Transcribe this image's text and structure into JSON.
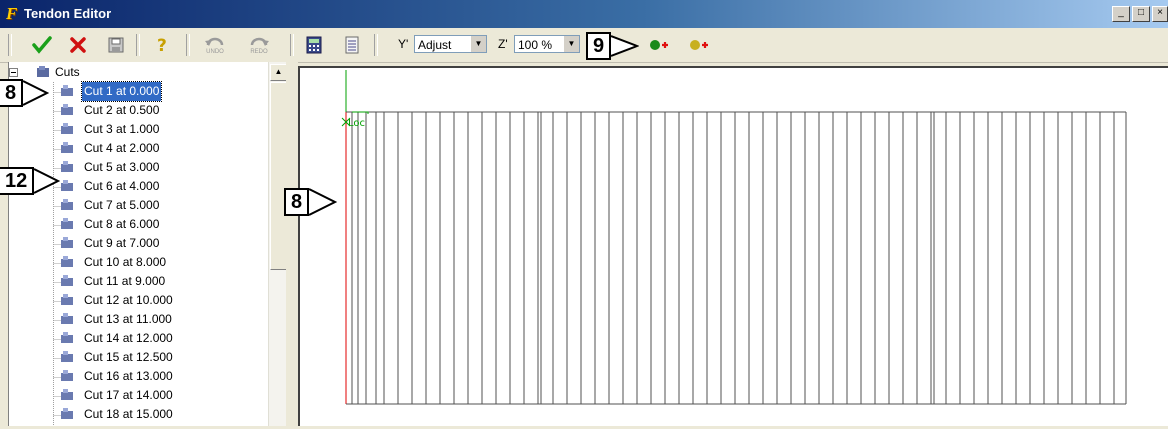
{
  "window": {
    "title": "Tendon Editor",
    "min": "_",
    "max": "□",
    "close": "×"
  },
  "toolbar": {
    "accept_icon": "check-icon",
    "y_label": "Y'",
    "y_combo": "Adjust",
    "z_label": "Z'",
    "zoom_combo": "100 %",
    "undo_label": "UNDO",
    "redo_label": "REDO"
  },
  "callouts": {
    "toolbar": "9",
    "tree_top": "8",
    "tree_mid": "12",
    "canvas": "8"
  },
  "tree": {
    "root": "Cuts",
    "items": [
      "Cut 1 at 0.000",
      "Cut 2 at 0.500",
      "Cut 3 at 1.000",
      "Cut 4 at 2.000",
      "Cut 5 at 3.000",
      "Cut 6 at 4.000",
      "Cut 7 at 5.000",
      "Cut 8 at 6.000",
      "Cut 9 at 7.000",
      "Cut 10 at 8.000",
      "Cut 11 at 9.000",
      "Cut 12 at 10.000",
      "Cut 13 at 11.000",
      "Cut 14 at 12.000",
      "Cut 15 at 12.500",
      "Cut 16 at 13.000",
      "Cut 17 at 14.000",
      "Cut 18 at 15.000"
    ],
    "selected_index": 0
  },
  "canvas": {
    "loc_label": "Loc"
  },
  "colors": {
    "accept": "#1aa01a",
    "reject": "#d01010",
    "axis_red": "#e00000",
    "axis_green": "#00a000",
    "selection": "#316ac5"
  }
}
